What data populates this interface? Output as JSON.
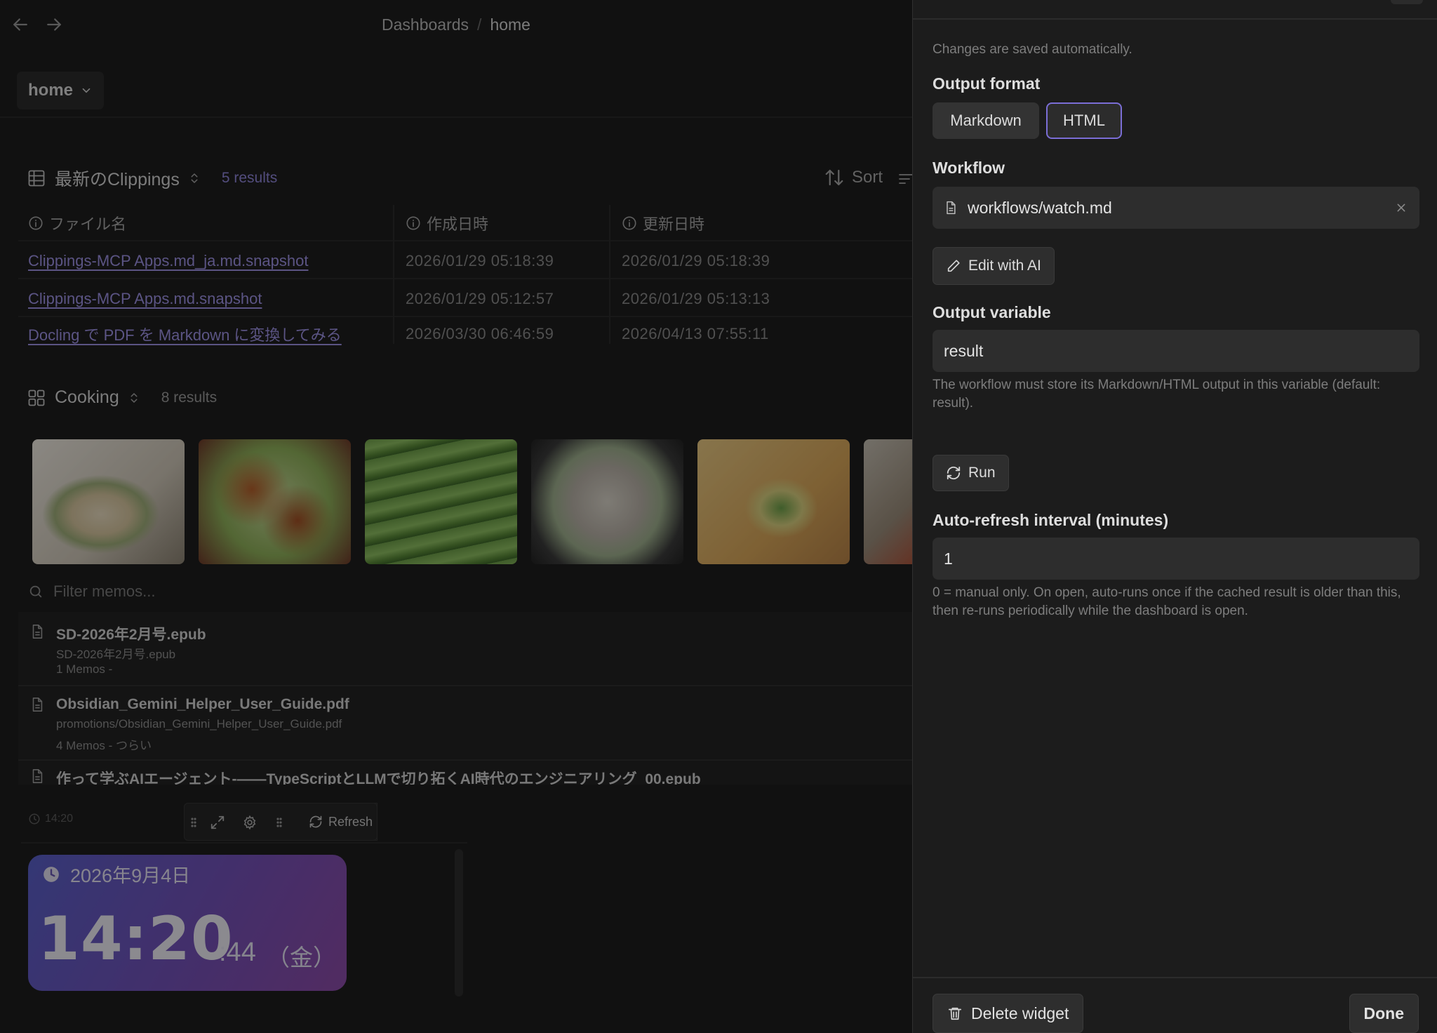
{
  "breadcrumb": {
    "parent": "Dashboards",
    "separator": "/",
    "current": "home"
  },
  "dashboard_select": {
    "value": "home"
  },
  "clippings": {
    "title": "最新のClippings",
    "count": "5 results",
    "sort_label": "Sort",
    "columns": [
      "ファイル名",
      "作成日時",
      "更新日時"
    ],
    "rows": [
      {
        "name": "Clippings-MCP Apps.md_ja.md.snapshot",
        "created": "2026/01/29 05:18:39",
        "updated": "2026/01/29 05:18:39"
      },
      {
        "name": "Clippings-MCP Apps.md.snapshot",
        "created": "2026/01/29 05:12:57",
        "updated": "2026/01/29 05:13:13"
      },
      {
        "name": "Docling で PDF を Markdown に変換してみる",
        "created": "2026/03/30 06:46:59",
        "updated": "2026/04/13 07:55:11"
      }
    ]
  },
  "cooking": {
    "title": "Cooking",
    "count": "8 results"
  },
  "memos": {
    "filter_placeholder": "Filter memos...",
    "items": [
      {
        "title": "SD-2026年2月号.epub",
        "path": "SD-2026年2月号.epub",
        "meta": "1 Memos -"
      },
      {
        "title": "Obsidian_Gemini_Helper_User_Guide.pdf",
        "path": "promotions/Obsidian_Gemini_Helper_User_Guide.pdf",
        "meta": "4 Memos - つらい"
      },
      {
        "title": "作って学ぶAIエージェント-——TypeScriptとLLMで切り拓くAI時代のエンジニアリング_00.epub"
      }
    ]
  },
  "widget_toolbar": {
    "time": "14:20",
    "refresh_label": "Refresh"
  },
  "clock": {
    "date": "2026年9月4日",
    "time": "14:20",
    "seconds": ":44",
    "weekday": "（金）"
  },
  "panel": {
    "autosave_note": "Changes are saved automatically.",
    "output_format": {
      "label": "Output format",
      "options": [
        "Markdown",
        "HTML"
      ],
      "selected": "HTML"
    },
    "workflow": {
      "label": "Workflow",
      "value": "workflows/watch.md"
    },
    "edit_ai_label": "Edit with AI",
    "output_variable": {
      "label": "Output variable",
      "value": "result",
      "help": "The workflow must store its Markdown/HTML output in this variable (default: result)."
    },
    "run_label": "Run",
    "auto_refresh": {
      "label": "Auto-refresh interval (minutes)",
      "value": "1",
      "help": "0 = manual only. On open, auto-runs once if the cached result is older than this, then re-runs periodically while the dashboard is open."
    },
    "delete_label": "Delete widget",
    "done_label": "Done"
  },
  "colors": {
    "accent": "#7b6ed6",
    "link": "#9d92e4",
    "panel_bg": "#1c1c1c",
    "clock_gradient_start": "#5a60c9",
    "clock_gradient_end": "#8d4ca8"
  }
}
